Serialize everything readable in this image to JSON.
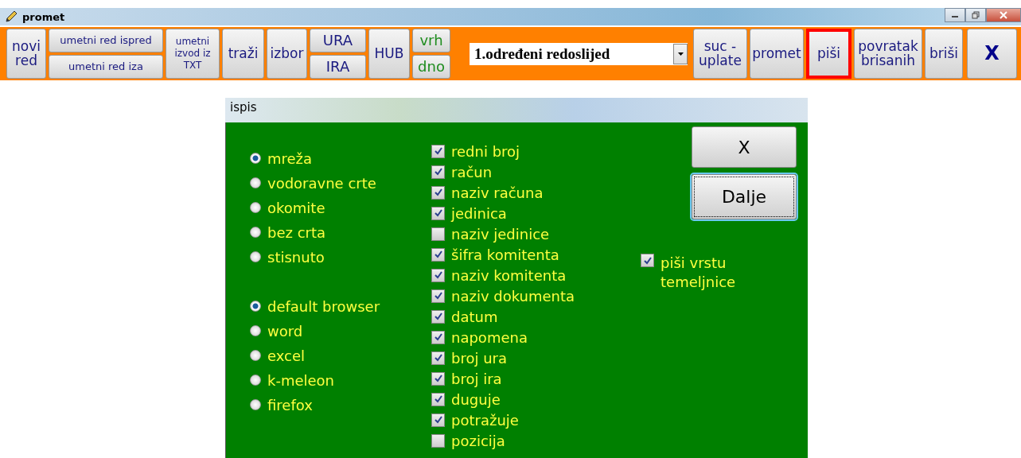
{
  "window": {
    "title": "promet"
  },
  "toolbar": [
    {
      "kind": "single",
      "label": "novi\nred",
      "highlighted": false,
      "color": "#1a1a80"
    },
    {
      "kind": "stack",
      "buttons": [
        {
          "label": "umetni red ispred",
          "color": "#1a1a80"
        },
        {
          "label": "umetni red iza",
          "color": "#1a1a80"
        }
      ]
    },
    {
      "kind": "small",
      "label": "umetni\nizvod iz\nTXT",
      "highlighted": false,
      "color": "#1a1a80"
    },
    {
      "kind": "single",
      "label": "traži",
      "highlighted": false,
      "color": "#1a1a80"
    },
    {
      "kind": "single",
      "label": "izbor",
      "highlighted": false,
      "color": "#1a1a80"
    },
    {
      "kind": "stack",
      "buttons": [
        {
          "label": "URA",
          "color": "#1a1a80"
        },
        {
          "label": "IRA",
          "color": "#1a1a80"
        }
      ]
    },
    {
      "kind": "single",
      "label": "HUB",
      "highlighted": false,
      "color": "#1a1a80"
    },
    {
      "kind": "stack",
      "buttons": [
        {
          "label": "vrh",
          "color": "#1e8c1e"
        },
        {
          "label": "dno",
          "color": "#1e8c1e"
        }
      ]
    },
    {
      "kind": "dropdown",
      "value": "1.određeni redoslijed"
    },
    {
      "kind": "single",
      "label": "suc -\nuplate",
      "highlighted": false,
      "color": "#1a1a80"
    },
    {
      "kind": "single",
      "label": "promet",
      "highlighted": false,
      "color": "#1a1a80"
    },
    {
      "kind": "single",
      "label": "piši",
      "highlighted": true,
      "color": "#1a1a80"
    },
    {
      "kind": "single",
      "label": "povratak\nbrisanih",
      "highlighted": false,
      "color": "#1a1a80"
    },
    {
      "kind": "single",
      "label": "briši",
      "highlighted": false,
      "color": "#1a1a80"
    },
    {
      "kind": "close",
      "label": "X"
    }
  ],
  "dialog": {
    "title": "ispis",
    "grid_options": [
      {
        "label": "mreža",
        "selected": true
      },
      {
        "label": "vodoravne crte",
        "selected": false
      },
      {
        "label": "okomite",
        "selected": false
      },
      {
        "label": "bez crta",
        "selected": false
      },
      {
        "label": "stisnuto",
        "selected": false
      }
    ],
    "output_options": [
      {
        "label": "default browser",
        "selected": true
      },
      {
        "label": "word",
        "selected": false
      },
      {
        "label": "excel",
        "selected": false
      },
      {
        "label": "k-meleon",
        "selected": false
      },
      {
        "label": "firefox",
        "selected": false
      }
    ],
    "columns": [
      {
        "label": "redni broj",
        "checked": true
      },
      {
        "label": "račun",
        "checked": true
      },
      {
        "label": "naziv računa",
        "checked": true
      },
      {
        "label": "jedinica",
        "checked": true
      },
      {
        "label": "naziv jedinice",
        "checked": false
      },
      {
        "label": "šifra komitenta",
        "checked": true
      },
      {
        "label": "naziv komitenta",
        "checked": true
      },
      {
        "label": "naziv dokumenta",
        "checked": true
      },
      {
        "label": "datum",
        "checked": true
      },
      {
        "label": "napomena",
        "checked": true
      },
      {
        "label": "broj ura",
        "checked": true
      },
      {
        "label": "broj ira",
        "checked": true
      },
      {
        "label": "duguje",
        "checked": true
      },
      {
        "label": "potražuje",
        "checked": true
      },
      {
        "label": "pozicija",
        "checked": false
      }
    ],
    "extra_option": {
      "label": "piši vrstu\ntemeljnice",
      "checked": true
    },
    "buttons": [
      {
        "label": "X",
        "focused": false
      },
      {
        "label": "Dalje",
        "focused": true
      }
    ]
  }
}
